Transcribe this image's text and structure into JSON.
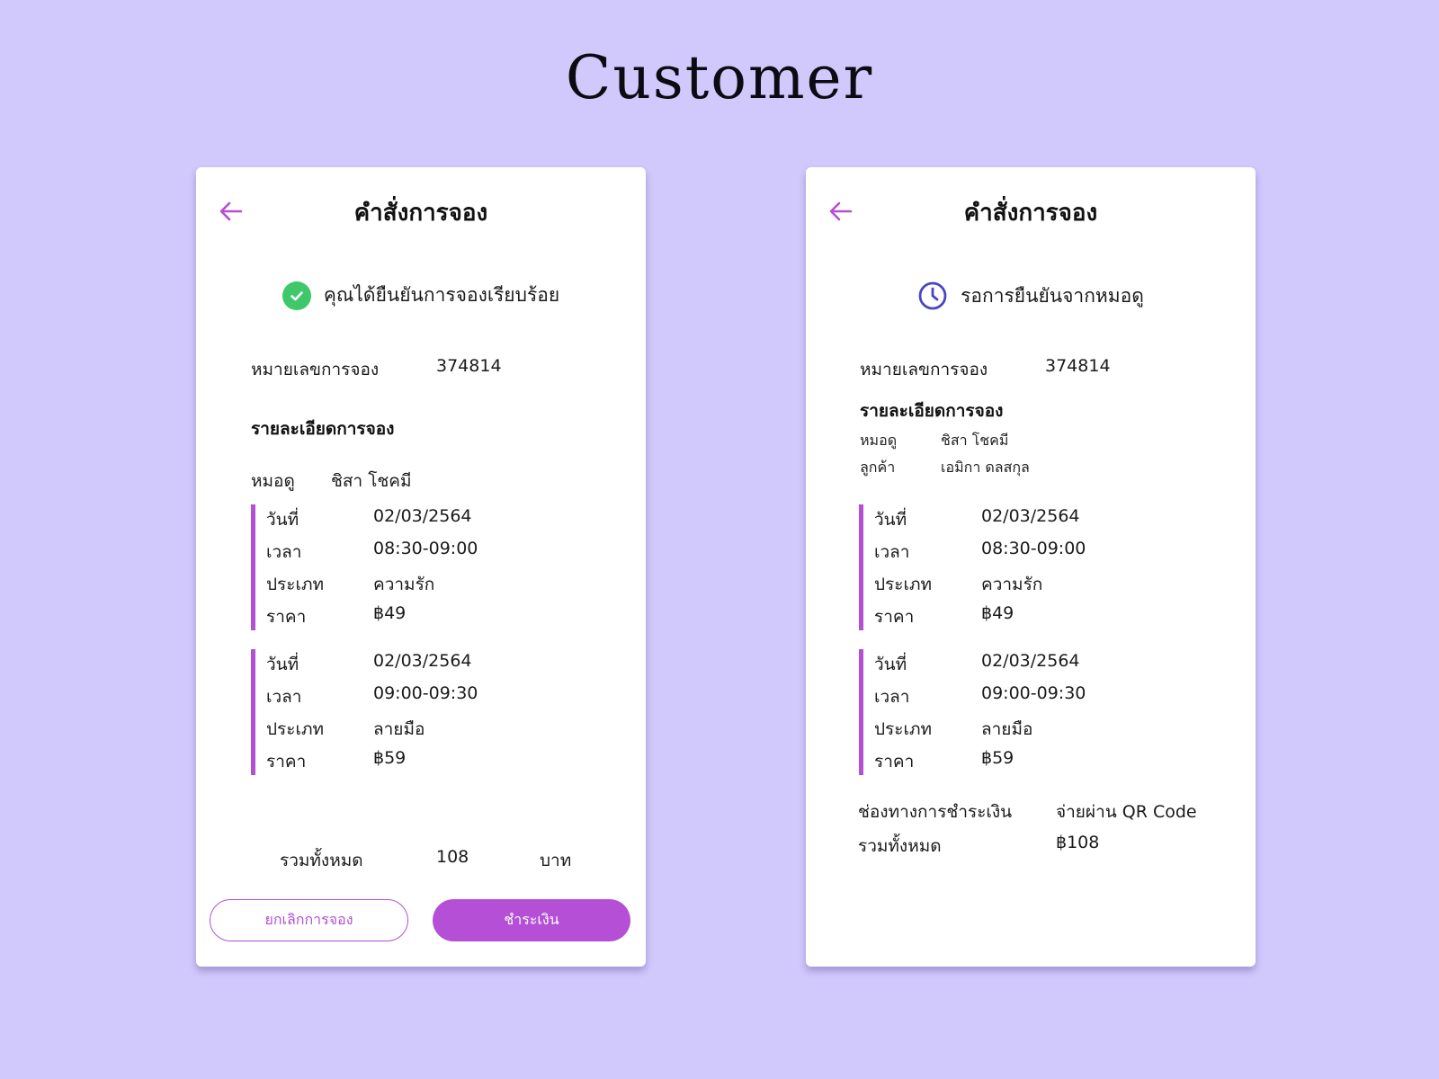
{
  "heading": "Customer",
  "colors": {
    "background": "#d1c8fc",
    "accent": "#b44fd6",
    "success": "#3ec86a",
    "pending": "#4b45c4"
  },
  "left_card": {
    "back_icon": "arrow-left-icon",
    "title": "คำสั่งการจอง",
    "status_icon": "check-circle-icon",
    "status_text": "คุณได้ยืนยันการจองเรียบร้อย",
    "booking_number_label": "หมายเลขการจอง",
    "booking_number": "374814",
    "details_heading": "รายละเอียดการจอง",
    "fortune_teller_label": "หมอดู",
    "fortune_teller_name": "ชิสา โชคมี",
    "slots": [
      {
        "date_label": "วันที่",
        "date": "02/03/2564",
        "time_label": "เวลา",
        "time": "08:30-09:00",
        "type_label": "ประเภท",
        "type": "ความรัก",
        "price_label": "ราคา",
        "price": "฿49"
      },
      {
        "date_label": "วันที่",
        "date": "02/03/2564",
        "time_label": "เวลา",
        "time": "09:00-09:30",
        "type_label": "ประเภท",
        "type": "ลายมือ",
        "price_label": "ราคา",
        "price": "฿59"
      }
    ],
    "total_label": "รวมทั้งหมด",
    "total_value": "108",
    "total_unit": "บาท",
    "cancel_button": "ยกเลิกการจอง",
    "pay_button": "ชำระเงิน"
  },
  "right_card": {
    "back_icon": "arrow-left-icon",
    "title": "คำสั่งการจอง",
    "status_icon": "clock-icon",
    "status_text": "รอการยืนยันจากหมอดู",
    "booking_number_label": "หมายเลขการจอง",
    "booking_number": "374814",
    "details_heading": "รายละเอียดการจอง",
    "fortune_teller_label": "หมอดู",
    "fortune_teller_name": "ชิสา โชคมี",
    "customer_label": "ลูกค้า",
    "customer_name": "เอมิกา ดลสกุล",
    "slots": [
      {
        "date_label": "วันที่",
        "date": "02/03/2564",
        "time_label": "เวลา",
        "time": "08:30-09:00",
        "type_label": "ประเภท",
        "type": "ความรัก",
        "price_label": "ราคา",
        "price": "฿49"
      },
      {
        "date_label": "วันที่",
        "date": "02/03/2564",
        "time_label": "เวลา",
        "time": "09:00-09:30",
        "type_label": "ประเภท",
        "type": "ลายมือ",
        "price_label": "ราคา",
        "price": "฿59"
      }
    ],
    "payment_channel_label": "ช่องทางการชำระเงิน",
    "payment_channel": "จ่ายผ่าน QR Code",
    "total_label": "รวมทั้งหมด",
    "total": "฿108"
  }
}
